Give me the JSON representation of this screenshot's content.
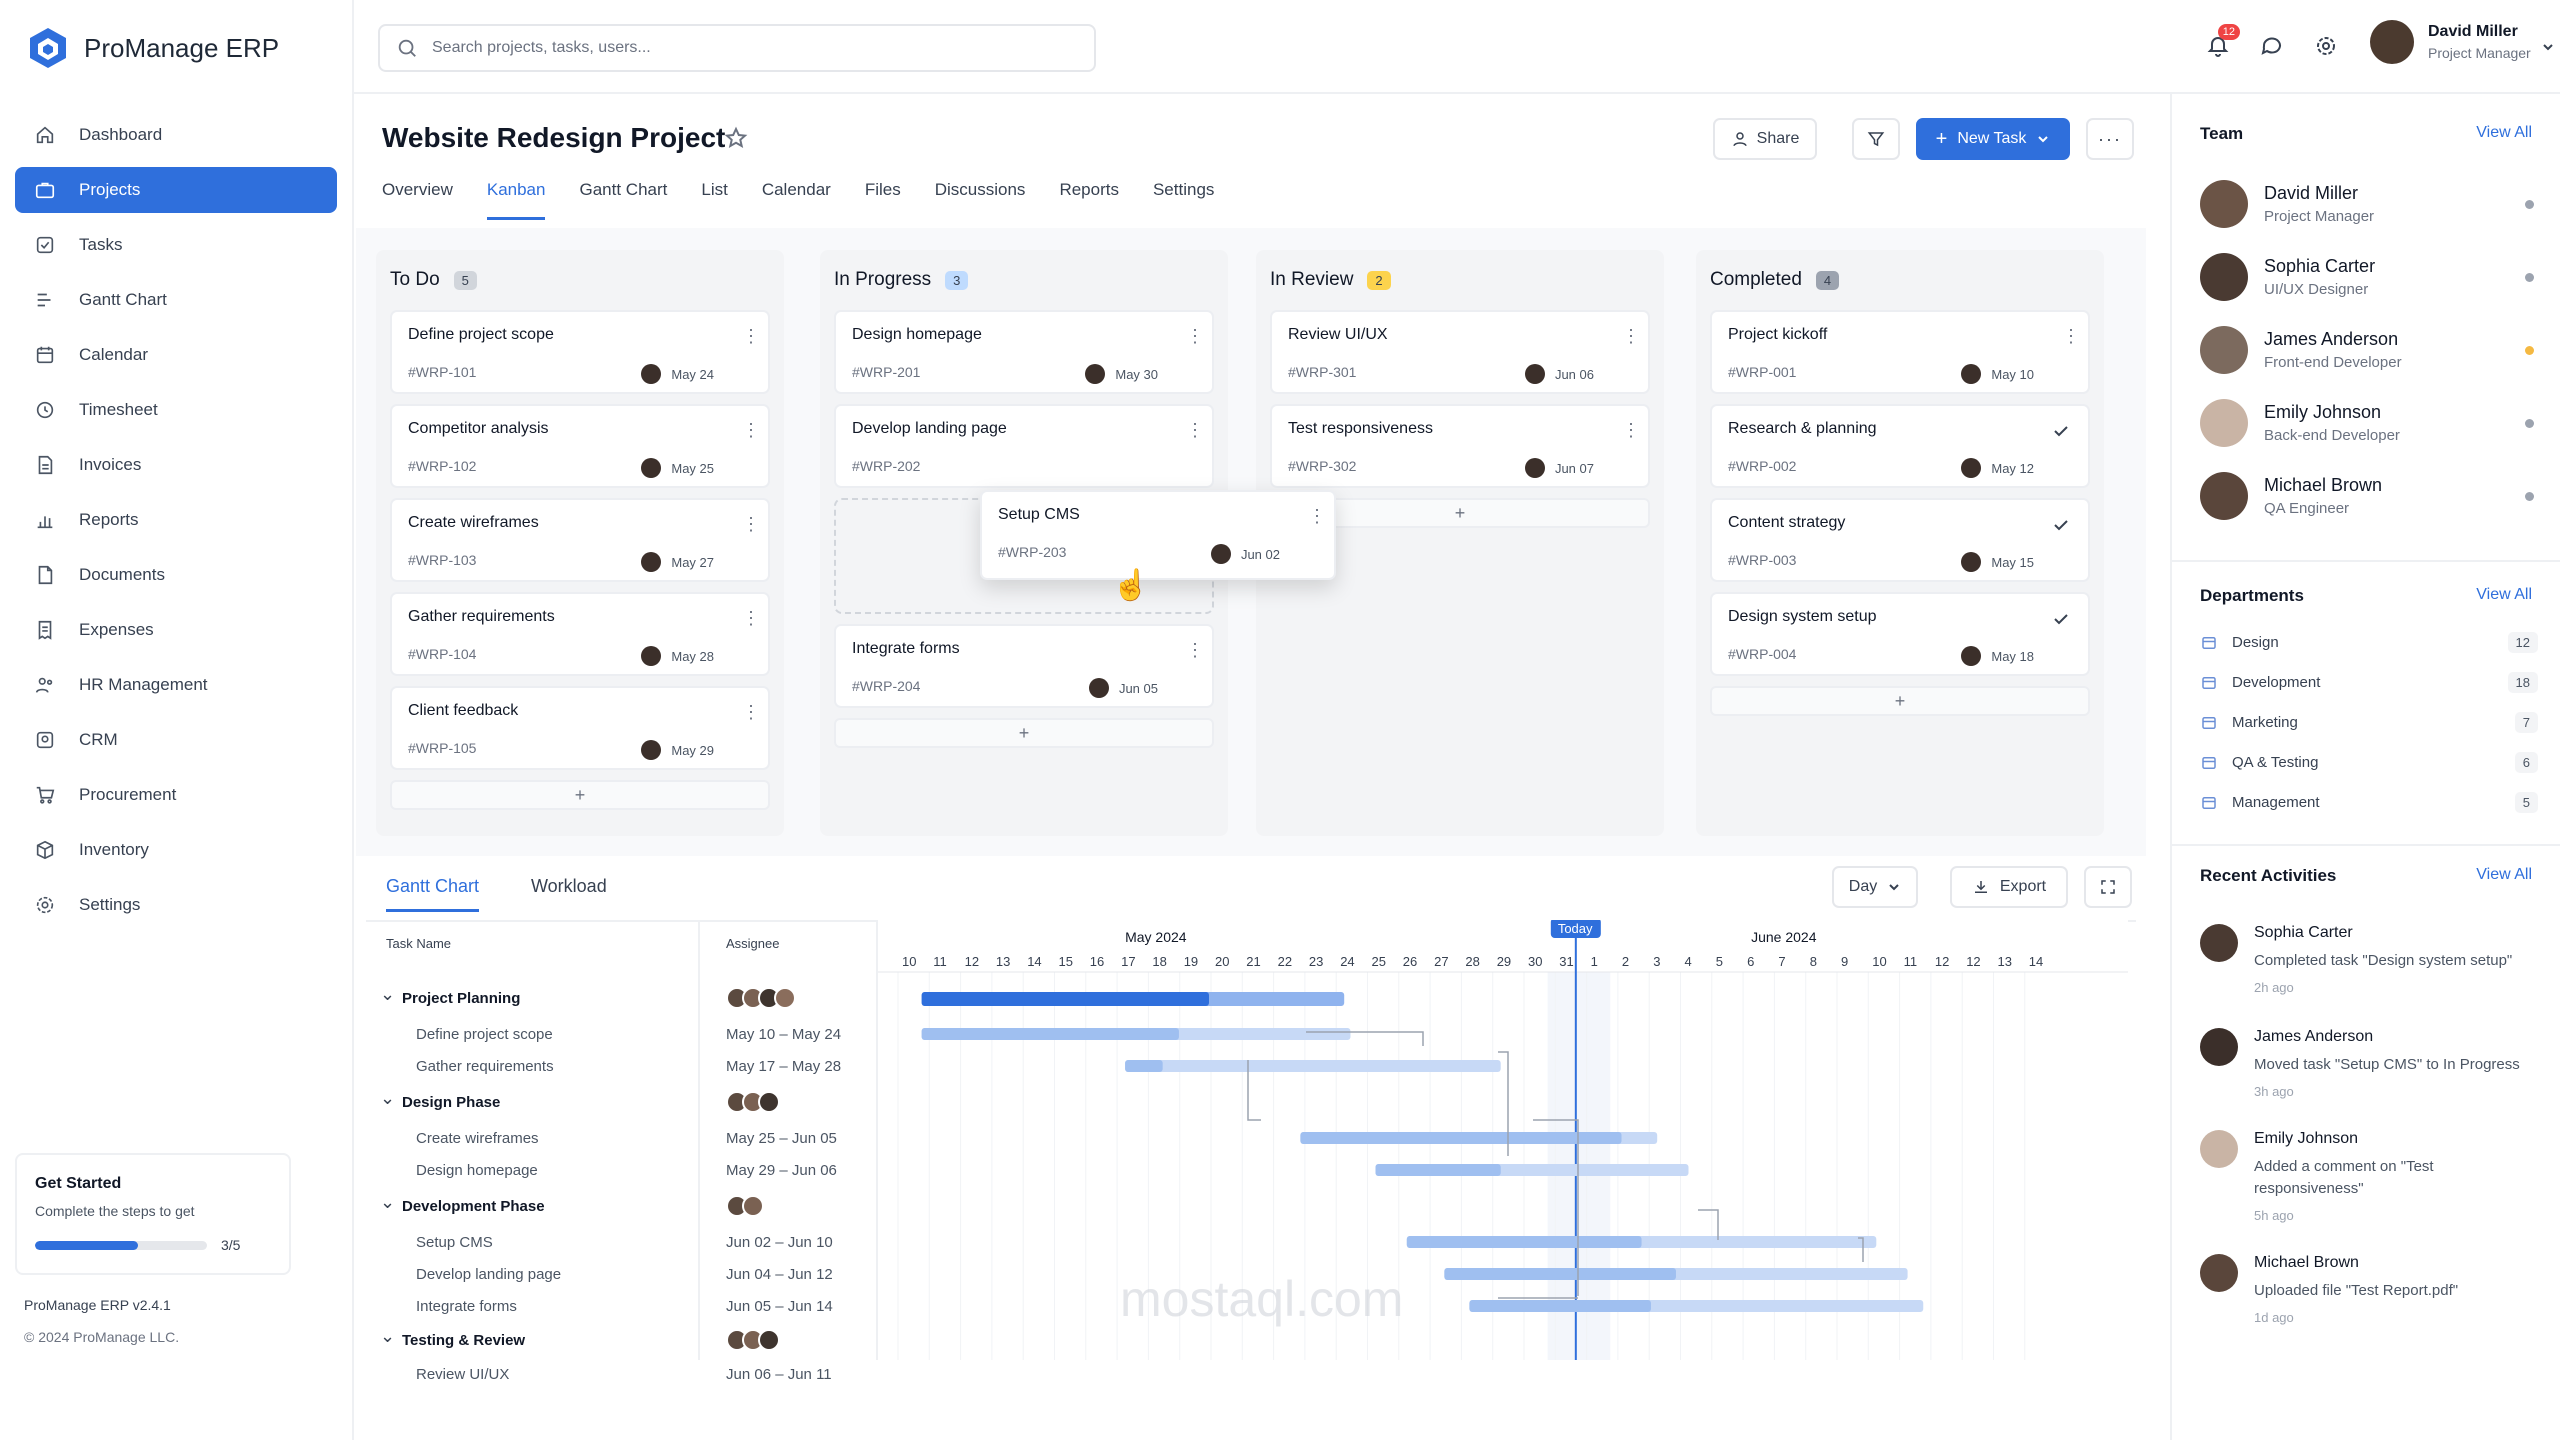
{
  "app": {
    "name": "ProManage ERP",
    "version": "ProManage ERP v2.4.1",
    "copyright": "© 2024 ProManage LLC."
  },
  "colors": {
    "accent": "#2f6fdc",
    "badge_red": "#ef4444",
    "in_review_badge": "#f59e0b"
  },
  "sidebar": {
    "items": [
      {
        "label": "Dashboard",
        "icon": "home-icon"
      },
      {
        "label": "Projects",
        "icon": "briefcase-icon",
        "active": true
      },
      {
        "label": "Tasks",
        "icon": "checkbox-icon"
      },
      {
        "label": "Gantt Chart",
        "icon": "gantt-icon"
      },
      {
        "label": "Calendar",
        "icon": "calendar-icon"
      },
      {
        "label": "Timesheet",
        "icon": "clock-icon"
      },
      {
        "label": "Invoices",
        "icon": "invoice-icon"
      },
      {
        "label": "Reports",
        "icon": "bar-chart-icon"
      },
      {
        "label": "Documents",
        "icon": "document-icon"
      },
      {
        "label": "Expenses",
        "icon": "expense-icon"
      },
      {
        "label": "HR Management",
        "icon": "people-icon"
      },
      {
        "label": "CRM",
        "icon": "crm-icon"
      },
      {
        "label": "Procurement",
        "icon": "cart-icon"
      },
      {
        "label": "Inventory",
        "icon": "box-icon"
      },
      {
        "label": "Settings",
        "icon": "gear-icon"
      }
    ],
    "get_started": {
      "title": "Get Started",
      "subtitle": "Complete the steps to get",
      "progress_text": "3/5",
      "progress": 0.6
    }
  },
  "topbar": {
    "search_placeholder": "Search projects, tasks, users...",
    "notification_count": "12",
    "user": {
      "name": "David Miller",
      "role": "Project Manager"
    }
  },
  "project": {
    "title": "Website Redesign Project",
    "share_label": "Share",
    "new_task_label": "New Task",
    "tabs": [
      "Overview",
      "Kanban",
      "Gantt Chart",
      "List",
      "Calendar",
      "Files",
      "Discussions",
      "Reports",
      "Settings"
    ],
    "active_tab": "Kanban"
  },
  "kanban": {
    "columns": [
      {
        "title": "To Do",
        "count": "5",
        "cards": [
          {
            "title": "Define project scope",
            "id": "#WRP-101",
            "date": "May 24"
          },
          {
            "title": "Competitor analysis",
            "id": "#WRP-102",
            "date": "May 25"
          },
          {
            "title": "Create wireframes",
            "id": "#WRP-103",
            "date": "May 27"
          },
          {
            "title": "Gather requirements",
            "id": "#WRP-104",
            "date": "May 28"
          },
          {
            "title": "Client feedback",
            "id": "#WRP-105",
            "date": "May 29"
          }
        ]
      },
      {
        "title": "In Progress",
        "count": "3",
        "cards": [
          {
            "title": "Design homepage",
            "id": "#WRP-201",
            "date": "May 30"
          },
          {
            "title": "Develop landing page",
            "id": "#WRP-202",
            "date": ""
          },
          {
            "title": "Integrate forms",
            "id": "#WRP-204",
            "date": "Jun 05"
          }
        ]
      },
      {
        "title": "In Review",
        "count": "2",
        "cards": [
          {
            "title": "Review UI/UX",
            "id": "#WRP-301",
            "date": "Jun 06"
          },
          {
            "title": "Test responsiveness",
            "id": "#WRP-302",
            "date": "Jun 07"
          }
        ]
      },
      {
        "title": "Completed",
        "count": "4",
        "cards": [
          {
            "title": "Project kickoff",
            "id": "#WRP-001",
            "date": "May 10"
          },
          {
            "title": "Research & planning",
            "id": "#WRP-002",
            "date": "May 12"
          },
          {
            "title": "Content strategy",
            "id": "#WRP-003",
            "date": "May 15"
          },
          {
            "title": "Design system setup",
            "id": "#WRP-004",
            "date": "May 18"
          }
        ]
      }
    ],
    "dragging_card": {
      "title": "Setup CMS",
      "id": "#WRP-203",
      "date": "Jun 02"
    },
    "add_label": "+"
  },
  "gantt": {
    "tabs": [
      "Gantt Chart",
      "Workload"
    ],
    "view_label": "Day",
    "export_label": "Export",
    "col_task": "Task Name",
    "col_assignee": "Assignee",
    "month_may": "May 2024",
    "month_june": "June 2024",
    "today_label": "Today",
    "may_days": [
      "10",
      "11",
      "12",
      "13",
      "14",
      "15",
      "16",
      "17",
      "18",
      "19",
      "20",
      "21",
      "22",
      "23",
      "24",
      "25",
      "26",
      "27",
      "28",
      "29",
      "30",
      "31"
    ],
    "june_days": [
      "1",
      "2",
      "3",
      "4",
      "5",
      "6",
      "7",
      "8",
      "9",
      "10",
      "11",
      "12",
      "12",
      "13",
      "14"
    ],
    "rows": [
      {
        "name": "Project Planning",
        "group": true,
        "dates": ""
      },
      {
        "name": "Define project scope",
        "group": false,
        "dates": "May 10 – May 24"
      },
      {
        "name": "Gather requirements",
        "group": false,
        "dates": "May 17 – May 28"
      },
      {
        "name": "Design Phase",
        "group": true,
        "dates": ""
      },
      {
        "name": "Create wireframes",
        "group": false,
        "dates": "May 25 – Jun 05"
      },
      {
        "name": "Design homepage",
        "group": false,
        "dates": "May 29 – Jun 06"
      },
      {
        "name": "Development Phase",
        "group": true,
        "dates": ""
      },
      {
        "name": "Setup CMS",
        "group": false,
        "dates": "Jun 02 – Jun 10"
      },
      {
        "name": "Develop landing page",
        "group": false,
        "dates": "Jun 04 – Jun 12"
      },
      {
        "name": "Integrate forms",
        "group": false,
        "dates": "Jun 05 – Jun 14"
      },
      {
        "name": "Testing & Review",
        "group": true,
        "dates": ""
      },
      {
        "name": "Review UI/UX",
        "group": false,
        "dates": "Jun 06 – Jun 11"
      }
    ]
  },
  "right_panel": {
    "team_title": "Team",
    "view_all": "View All",
    "team": [
      {
        "name": "David Miller",
        "role": "Project Manager",
        "status": "#9ca3af"
      },
      {
        "name": "Sophia Carter",
        "role": "UI/UX Designer",
        "status": "#9ca3af"
      },
      {
        "name": "James Anderson",
        "role": "Front-end Developer",
        "status": "#f5b942"
      },
      {
        "name": "Emily Johnson",
        "role": "Back-end Developer",
        "status": "#9ca3af"
      },
      {
        "name": "Michael Brown",
        "role": "QA Engineer",
        "status": "#9ca3af"
      }
    ],
    "departments_title": "Departments",
    "departments": [
      {
        "name": "Design",
        "count": "12"
      },
      {
        "name": "Development",
        "count": "18"
      },
      {
        "name": "Marketing",
        "count": "7"
      },
      {
        "name": "QA & Testing",
        "count": "6"
      },
      {
        "name": "Management",
        "count": "5"
      }
    ],
    "activities_title": "Recent Activities",
    "activities": [
      {
        "name": "Sophia Carter",
        "text": "Completed task \"Design system setup\"",
        "time": "2h ago"
      },
      {
        "name": "James Anderson",
        "text": "Moved task \"Setup CMS\" to In Progress",
        "time": "3h ago"
      },
      {
        "name": "Emily Johnson",
        "text": "Added a comment on \"Test responsiveness\"",
        "time": "5h ago"
      },
      {
        "name": "Michael Brown",
        "text": "Uploaded file \"Test Report.pdf\"",
        "time": "1d ago"
      }
    ]
  },
  "watermark": "mostaql.com"
}
